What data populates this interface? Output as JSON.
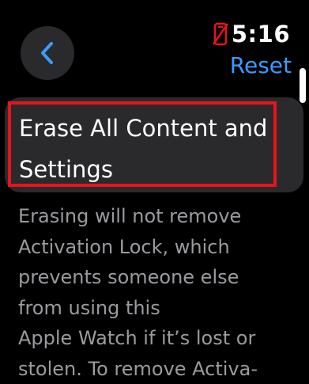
{
  "header": {
    "time": "5:16",
    "reset_label": "Reset",
    "back_icon": "chevron-left-icon",
    "status_icon": "phone-disconnected-icon"
  },
  "main": {
    "title": "Erase All Content and Settings",
    "description": "Erasing will not remove\nActivation Lock, which\nprevents someone else\nfrom using this\nApple Watch if it’s lost or\nstolen. To remove Activa-"
  },
  "colors": {
    "accent": "#3b9bff",
    "status_icon": "#e8131b",
    "highlight": "#e8131b",
    "card": "#2a2a2c",
    "description": "#9a9a9f"
  }
}
